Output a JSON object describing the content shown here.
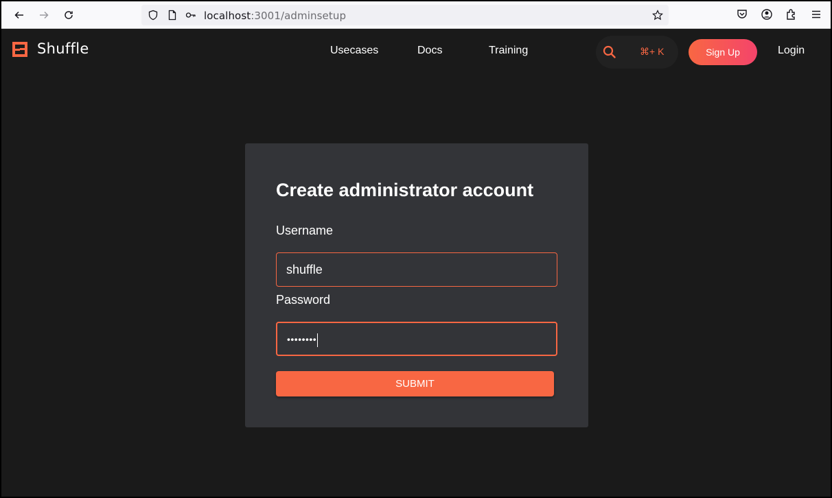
{
  "browser": {
    "url_host": "localhost",
    "url_path": ":3001/adminsetup"
  },
  "header": {
    "brand": "Shuffle",
    "nav": [
      "Usecases",
      "Docs",
      "Training"
    ],
    "search_shortcut": "⌘+ K",
    "signup_label": "Sign Up",
    "login_label": "Login"
  },
  "form": {
    "title": "Create administrator account",
    "username_label": "Username",
    "username_value": "shuffle",
    "password_label": "Password",
    "password_value": "••••••••",
    "submit_label": "SUBMIT"
  },
  "colors": {
    "accent": "#f86743",
    "accent_pink": "#f4446b",
    "background": "#1a1a1a",
    "card": "#333438"
  }
}
